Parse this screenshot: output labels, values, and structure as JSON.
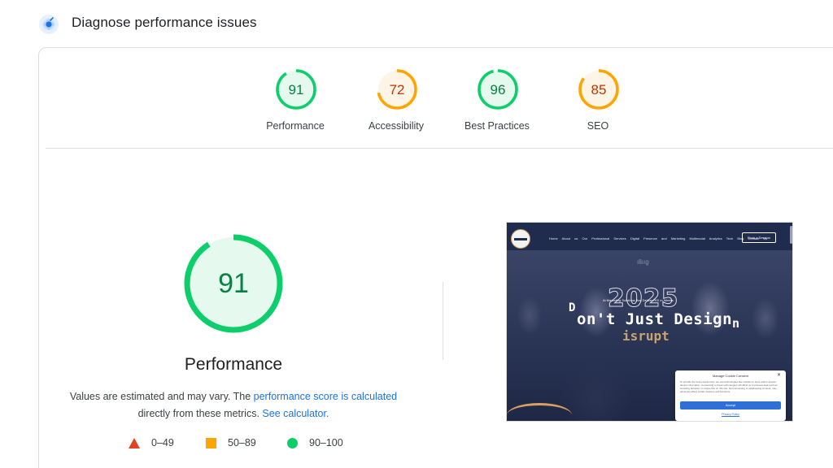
{
  "header": {
    "title": "Diagnose performance issues",
    "icon": "lighthouse-icon"
  },
  "gauges": [
    {
      "label": "Performance",
      "score": "91",
      "status": "pass",
      "color": "#0cce6b",
      "fill": "#e6f9ee",
      "text_color": "#0a8043"
    },
    {
      "label": "Accessibility",
      "score": "72",
      "status": "average",
      "color": "#ffa400",
      "fill": "#fff5e6",
      "text_color": "#c33300"
    },
    {
      "label": "Best Practices",
      "score": "96",
      "status": "pass",
      "color": "#0cce6b",
      "fill": "#e6f9ee",
      "text_color": "#0a8043"
    },
    {
      "label": "SEO",
      "score": "85",
      "status": "average",
      "color": "#ffa400",
      "fill": "#fff5e6",
      "text_color": "#c33300"
    }
  ],
  "detail": {
    "score": "91",
    "title": "Performance",
    "desc_part1": "Values are estimated and may vary. The ",
    "desc_link1": "performance score is calculated",
    "desc_part2": "directly from these metrics. ",
    "desc_link2": "See calculator."
  },
  "legend": [
    {
      "shape": "triangle",
      "color": "#e0441e",
      "label": "0–49"
    },
    {
      "shape": "square",
      "color": "#ffa400",
      "label": "50–89"
    },
    {
      "shape": "circle",
      "color": "#0cce6b",
      "label": "90–100"
    }
  ],
  "screenshot": {
    "nav_items": "Home   About us   Our Professional Services   Digital Presence and Marketing   Multimodal Analytics   Tech Blog   Contact Us",
    "cta": "Book a Session",
    "year": "2025",
    "small_line": "Ai Marketing Solutions that Deliver ROI in Weeks",
    "headline_d": "D",
    "headline": "on't Just Design",
    "headline_n": "n",
    "sub": "isrupt",
    "consent_title": "Manage Cookie Consent",
    "consent_text": "To provide the best experiences, we use technologies like cookies to store and/or access device information. Consenting to these technologies will allow us to process data such as browsing behavior or unique IDs on this site. Not consenting or withdrawing consent, may adversely affect certain features and functions.",
    "consent_accept": "Accept",
    "consent_link": "Privacy Policy"
  },
  "colors": {
    "pass": "#0cce6b",
    "average": "#ffa400",
    "fail": "#e0441e",
    "link": "#1a73e8"
  }
}
